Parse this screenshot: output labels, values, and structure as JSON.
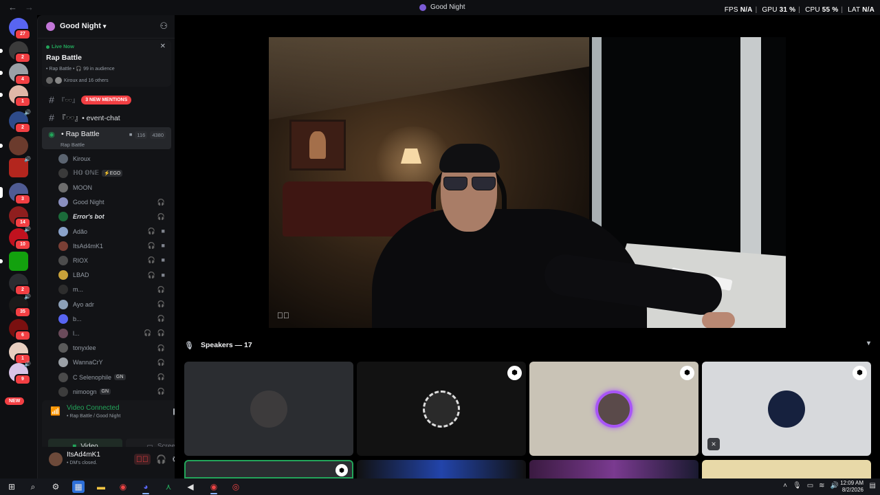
{
  "titlebar": {
    "back": "←",
    "forward": "→",
    "title": "Good Night"
  },
  "overlay": {
    "fps_label": "FPS",
    "fps_value": "N/A",
    "gpu_label": "GPU",
    "gpu_value": "31 %",
    "cpu_label": "CPU",
    "cpu_value": "55 %",
    "lat_label": "LAT",
    "lat_value": "N/A"
  },
  "rail": {
    "badges": [
      "27",
      "2",
      "4",
      "1",
      "2",
      "",
      "",
      "3",
      "14",
      "10",
      "",
      "2",
      "35",
      "6",
      "1",
      "9"
    ],
    "new_label": "NEW"
  },
  "guild": {
    "name": "Good Night"
  },
  "live": {
    "status": "Live Now",
    "title": "Rap Battle",
    "meta": "• Rap Battle • 🎧 99 in audience",
    "people": "Kiroux and 16 others"
  },
  "channels": {
    "mentions_label": "3 NEW MENTIONS",
    "event_chat": "『🕶️』• event-chat",
    "voice_name": "• Rap Battle",
    "voice_sub": "Rap Battle",
    "voice_video_count": "116",
    "voice_count": "4380"
  },
  "voice_users": [
    {
      "name": "Kiroux",
      "tag": "",
      "icons": ""
    },
    {
      "name": "ℍ𝕆 𝕆ℕ𝔼",
      "tag": "⚡EGO",
      "icons": ""
    },
    {
      "name": "MOON",
      "tag": "",
      "icons": ""
    },
    {
      "name": "Good Night",
      "tag": "",
      "icons": "🎧"
    },
    {
      "name": "Error's bot",
      "tag": "",
      "icons": "🎧"
    },
    {
      "name": "Adão",
      "tag": "",
      "icons": "🎧 ■"
    },
    {
      "name": "ItsAd4mK1",
      "tag": "",
      "icons": "🎧 ■"
    },
    {
      "name": "RIOX",
      "tag": "",
      "icons": "🎧 ■"
    },
    {
      "name": "LBAD",
      "tag": "",
      "icons": "🎧 ■"
    },
    {
      "name": "m...",
      "tag": "",
      "icons": "🎧"
    },
    {
      "name": "Ayo adr",
      "tag": "",
      "icons": "🎧"
    },
    {
      "name": "b...",
      "tag": "",
      "icons": "🎧"
    },
    {
      "name": "l...",
      "tag": "",
      "icons": "🎧 🎧"
    },
    {
      "name": "tonyxlee",
      "tag": "",
      "icons": "🎧"
    },
    {
      "name": "WannaCrY",
      "tag": "",
      "icons": "🎧"
    },
    {
      "name": "C Selenophile",
      "tag": "GN",
      "icons": "🎧"
    },
    {
      "name": "nimoogn",
      "tag": "GN",
      "icons": "🎧"
    }
  ],
  "voice_panel": {
    "status": "Video Connected",
    "sub": "• Rap Battle / Good Night",
    "video_label": "Video",
    "screen_label": "Screen"
  },
  "user": {
    "name": "ItsAd4mK1",
    "status": "• DM's closed."
  },
  "speakers": {
    "label": "Speakers — 17"
  },
  "taskbar": {
    "time": "12:09 AM",
    "date": "8/2/2026"
  },
  "colors": {
    "accent_green": "#23a55a",
    "mention_red": "#f23f43",
    "background": "#000000"
  }
}
